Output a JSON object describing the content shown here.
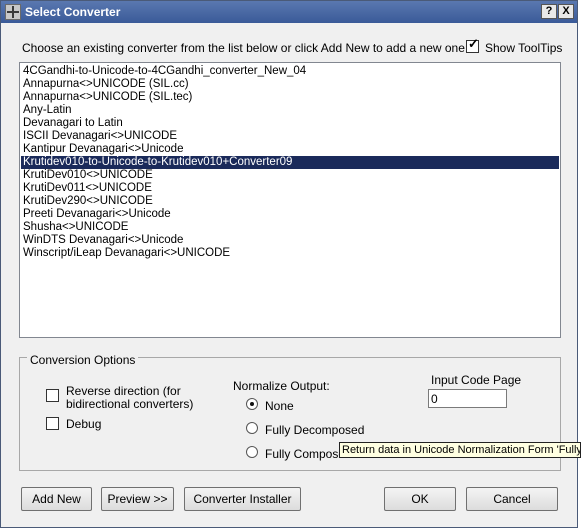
{
  "window": {
    "title": "Select Converter",
    "help_button": "?",
    "close_button": "X"
  },
  "instruction": "Choose an existing converter from the list below or click Add New to add a new one:",
  "show_tooltips": {
    "label": "Show ToolTips",
    "checked": true
  },
  "converters": {
    "items": [
      "4CGandhi-to-Unicode-to-4CGandhi_converter_New_04",
      "Annapurna<>UNICODE (SIL.cc)",
      "Annapurna<>UNICODE (SIL.tec)",
      "Any-Latin",
      "Devanagari to Latin",
      "ISCII Devanagari<>UNICODE",
      "Kantipur Devanagari<>Unicode",
      "Krutidev010-to-Unicode-to-Krutidev010+Converter09",
      "KrutiDev010<>UNICODE",
      "KrutiDev011<>UNICODE",
      "KrutiDev290<>UNICODE",
      "Preeti Devanagari<>Unicode",
      "Shusha<>UNICODE",
      "WinDTS Devanagari<>Unicode",
      "Winscript/iLeap Devanagari<>UNICODE"
    ],
    "selected_index": 7
  },
  "options": {
    "group_label": "Conversion Options",
    "reverse_direction": {
      "line1": "Reverse direction (for",
      "line2": "bidirectional converters)",
      "checked": false
    },
    "debug": {
      "label": "Debug",
      "checked": false
    },
    "normalize": {
      "label": "Normalize Output:",
      "choices": [
        "None",
        "Fully Decomposed",
        "Fully Composed"
      ],
      "selected": "None"
    },
    "input_code_page": {
      "label": "Input Code Page",
      "value": "0"
    }
  },
  "tooltip": "Return data in Unicode Normalization Form 'Fully D",
  "buttons": {
    "add_new": "Add New",
    "preview": "Preview >>",
    "converter_installer": "Converter Installer",
    "ok": "OK",
    "cancel": "Cancel"
  }
}
